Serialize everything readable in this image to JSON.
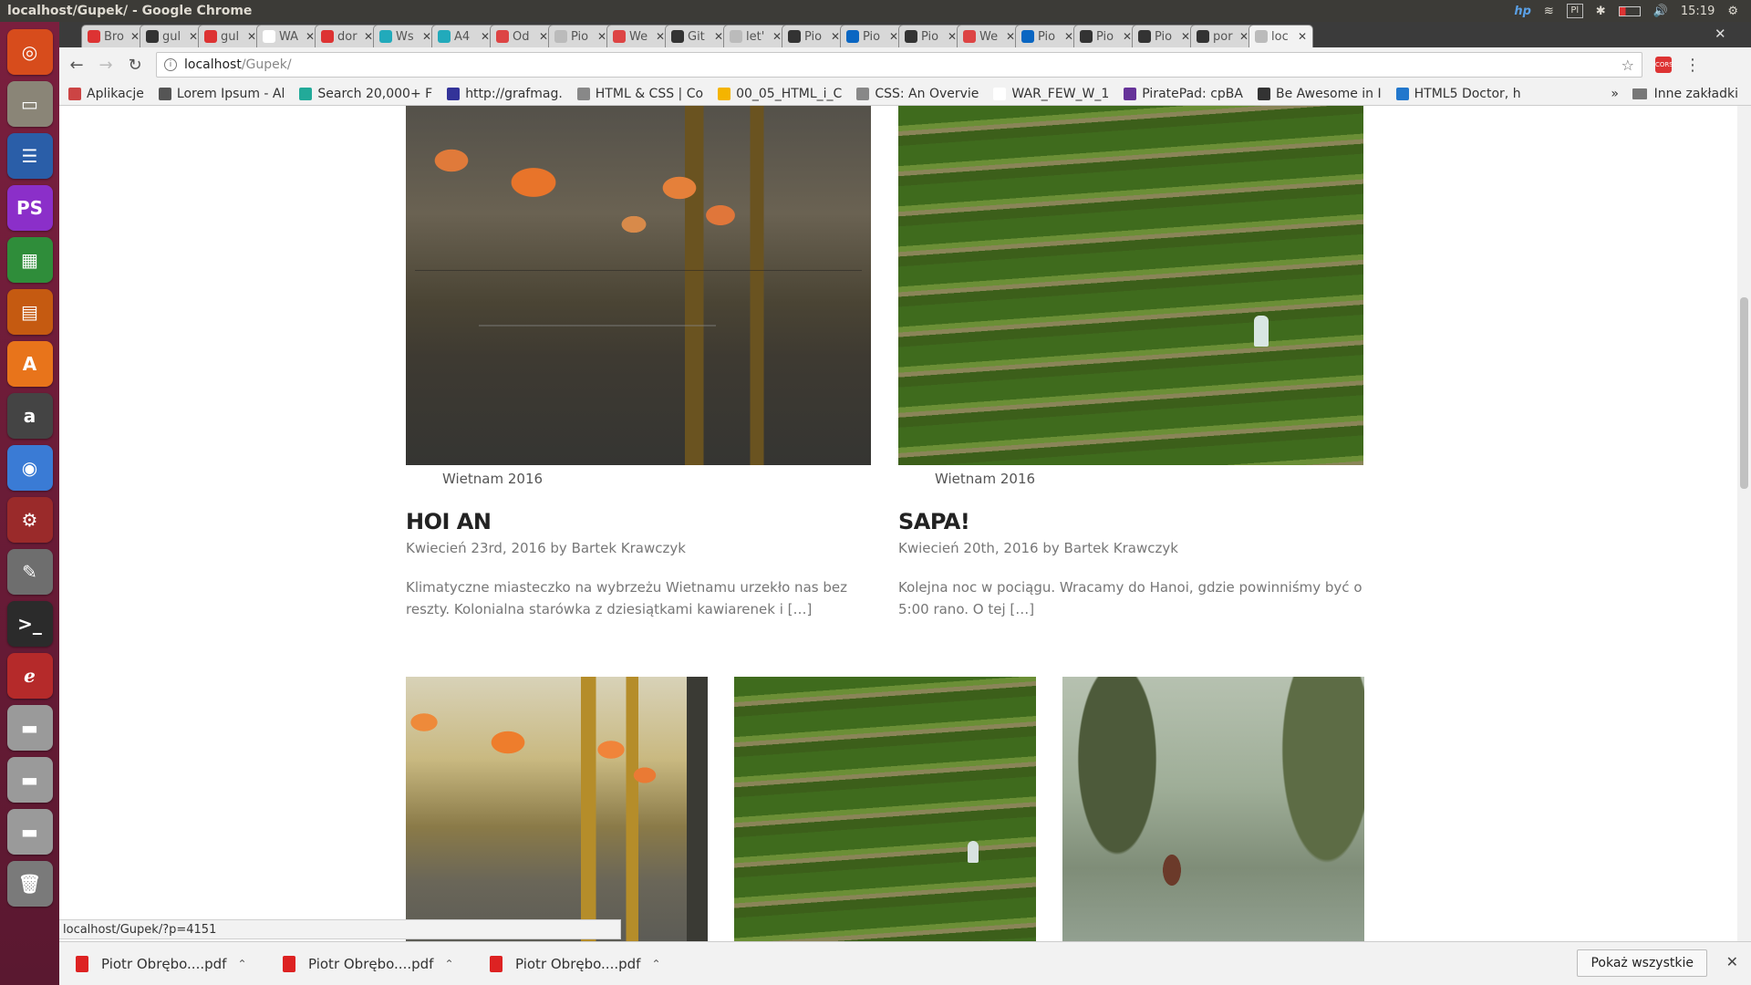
{
  "os": {
    "window_title": "localhost/Gupek/ - Google Chrome",
    "keyboard": "Pl",
    "clock": "15:19"
  },
  "launcher": [
    {
      "name": "ubuntu-dash-icon",
      "color": "#d74c1c",
      "glyph": "◎"
    },
    {
      "name": "files-icon",
      "color": "#8a8577",
      "glyph": "▭"
    },
    {
      "name": "writer-icon",
      "color": "#2a5ea8",
      "glyph": "☰"
    },
    {
      "name": "phpstorm-icon",
      "color": "#8b2fc9",
      "glyph": "PS"
    },
    {
      "name": "calc-icon",
      "color": "#2f8d3a",
      "glyph": "▦"
    },
    {
      "name": "impress-icon",
      "color": "#c55a11",
      "glyph": "▤"
    },
    {
      "name": "software-center-icon",
      "color": "#e8741b",
      "glyph": "A"
    },
    {
      "name": "amazon-icon",
      "color": "#444",
      "glyph": "a"
    },
    {
      "name": "chrome-icon",
      "color": "#3a7bd5",
      "glyph": "◉"
    },
    {
      "name": "settings-icon",
      "color": "#9a2a2a",
      "glyph": "⚙"
    },
    {
      "name": "text-editor-icon",
      "color": "#6e6e6e",
      "glyph": "✎"
    },
    {
      "name": "terminal-icon",
      "color": "#2b2b2b",
      "glyph": ">_"
    },
    {
      "name": "evince-icon",
      "color": "#b52a2a",
      "glyph": "ℯ"
    },
    {
      "name": "drive-icon",
      "color": "#9a9a9a",
      "glyph": "▬"
    },
    {
      "name": "drive-icon",
      "color": "#9a9a9a",
      "glyph": "▬"
    },
    {
      "name": "drive-icon",
      "color": "#9a9a9a",
      "glyph": "▬"
    },
    {
      "name": "trash-icon",
      "color": "#7a7a7a",
      "glyph": "🗑"
    }
  ],
  "tabs": [
    {
      "label": "Bro",
      "fav": "#d33"
    },
    {
      "label": "gul",
      "fav": "#333"
    },
    {
      "label": "gul",
      "fav": "#d33"
    },
    {
      "label": "WA",
      "fav": "#fff"
    },
    {
      "label": "dor",
      "fav": "#d33"
    },
    {
      "label": "Ws",
      "fav": "#2ab"
    },
    {
      "label": "A4",
      "fav": "#2ab"
    },
    {
      "label": "Od",
      "fav": "#d44"
    },
    {
      "label": "Pio",
      "fav": "#bbb"
    },
    {
      "label": "We",
      "fav": "#d44"
    },
    {
      "label": "Git",
      "fav": "#333"
    },
    {
      "label": "let'",
      "fav": "#bbb"
    },
    {
      "label": "Pio",
      "fav": "#333"
    },
    {
      "label": "Pio",
      "fav": "#0a66c2"
    },
    {
      "label": "Pio",
      "fav": "#333"
    },
    {
      "label": "We",
      "fav": "#d44"
    },
    {
      "label": "Pio",
      "fav": "#0a66c2"
    },
    {
      "label": "Pio",
      "fav": "#333"
    },
    {
      "label": "Pio",
      "fav": "#333"
    },
    {
      "label": "por",
      "fav": "#333"
    },
    {
      "label": "loc",
      "fav": "#bbb"
    }
  ],
  "omnibox": {
    "host": "localhost",
    "path": "/Gupek/",
    "ext_label": "CORS"
  },
  "bookmarks": [
    {
      "label": "Aplikacje",
      "color": "#c44"
    },
    {
      "label": "Lorem Ipsum - Al",
      "color": "#555"
    },
    {
      "label": "Search 20,000+ F",
      "color": "#2a9"
    },
    {
      "label": "http://grafmag.",
      "color": "#339"
    },
    {
      "label": "HTML & CSS | Co",
      "color": "#888"
    },
    {
      "label": "00_05_HTML_i_C",
      "color": "#f4b400"
    },
    {
      "label": "CSS: An Overvie",
      "color": "#888"
    },
    {
      "label": "WAR_FEW_W_1",
      "color": "#fff"
    },
    {
      "label": "PiratePad: cpBA",
      "color": "#639"
    },
    {
      "label": "Be Awesome in I",
      "color": "#333"
    },
    {
      "label": "HTML5 Doctor, h",
      "color": "#27c"
    }
  ],
  "bookmarks_more": "»",
  "bookmarks_other": "Inne zakładki",
  "posts": [
    {
      "category": "Wietnam 2016",
      "title": "HOI AN",
      "meta": "Kwiecień 23rd, 2016 by Bartek Krawczyk",
      "excerpt": "Klimatyczne miasteczko na wybrzeżu Wietnamu urzekło nas bez reszty. Kolonialna starówka z dziesiątkami kawiarenek i […]"
    },
    {
      "category": "Wietnam 2016",
      "title": "SAPA!",
      "meta": "Kwiecień 20th, 2016 by Bartek Krawczyk",
      "excerpt": "Kolejna noc w pociągu. Wracamy do Hanoi, gdzie powinniśmy być o 5:00 rano. O tej […]"
    }
  ],
  "status_url": "localhost/Gupek/?p=4151",
  "downloads": [
    {
      "label": "Piotr Obrębo....pdf"
    },
    {
      "label": "Piotr Obrębo....pdf"
    },
    {
      "label": "Piotr Obrębo....pdf"
    }
  ],
  "show_all": "Pokaż wszystkie"
}
